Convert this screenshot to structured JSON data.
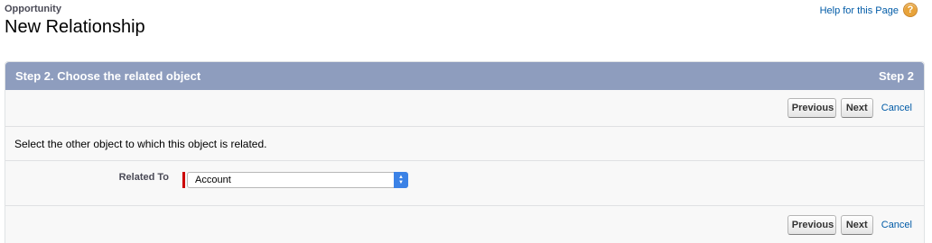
{
  "header": {
    "object_label": "Opportunity",
    "title": "New Relationship",
    "help_text": "Help for this Page",
    "help_icon": "?"
  },
  "step": {
    "title": "Step 2. Choose the related object",
    "indicator": "Step 2"
  },
  "buttons": {
    "previous": "Previous",
    "next": "Next",
    "cancel": "Cancel"
  },
  "form": {
    "instruction": "Select the other object to which this object is related.",
    "related_to_label": "Related To",
    "related_to_value": "Account"
  },
  "colors": {
    "header_bar": "#8e9dbe",
    "link": "#015ba7",
    "required": "#cc0000",
    "select_arrow": "#3b82e6"
  }
}
